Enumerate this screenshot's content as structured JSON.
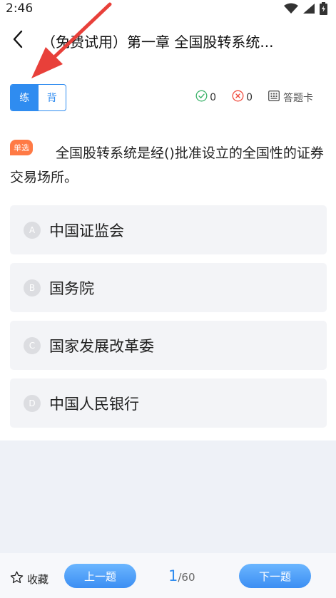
{
  "status_bar": {
    "time": "2:46",
    "icons": [
      "wifi-icon",
      "signal-icon",
      "battery-icon"
    ]
  },
  "header": {
    "title": "（免费试用）第一章 全国股转系统..."
  },
  "mode_toggle": {
    "practice_label": "练",
    "memorize_label": "背",
    "active": "练"
  },
  "stats": {
    "correct_count": "0",
    "wrong_count": "0",
    "answer_card_label": "答题卡"
  },
  "question": {
    "type_badge": "单选",
    "text": "全国股转系统是经()批准设立的全国性的证券交易场所。",
    "options": [
      {
        "letter": "A",
        "text": "中国证监会"
      },
      {
        "letter": "B",
        "text": "国务院"
      },
      {
        "letter": "C",
        "text": "国家发展改革委"
      },
      {
        "letter": "D",
        "text": "中国人民银行"
      }
    ]
  },
  "footer": {
    "favorite_label": "收藏",
    "prev_label": "上一题",
    "next_label": "下一题",
    "current_page": "1",
    "total_pages": "/60"
  },
  "colors": {
    "accent": "#2f8cf0",
    "badge": "#ff7a45",
    "correct": "#3bb36a",
    "wrong": "#f04a3c",
    "annotation_arrow": "#e8403a"
  }
}
